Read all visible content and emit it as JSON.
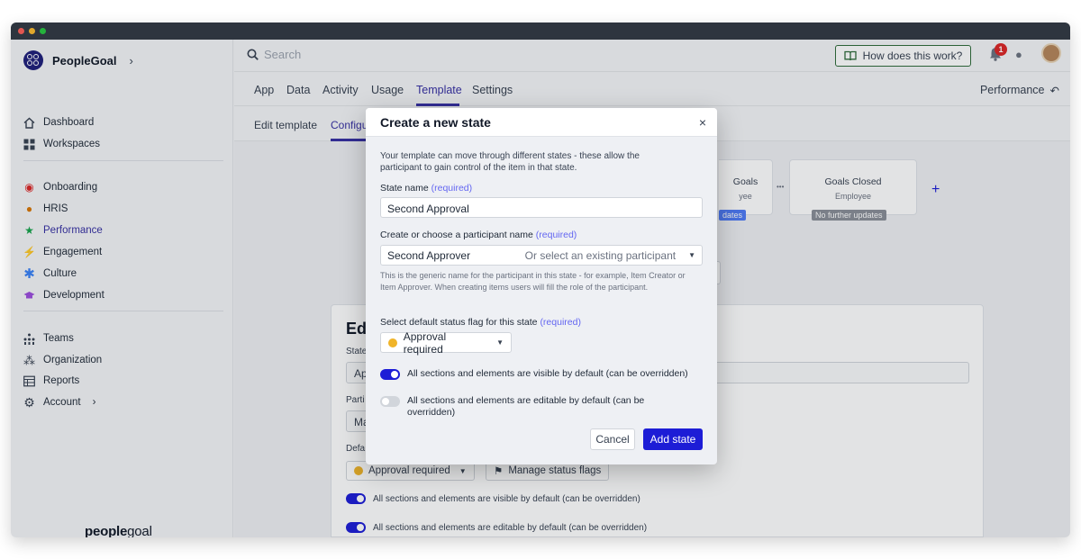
{
  "app": {
    "brand": "PeopleGoal",
    "footer_logo_bold": "people",
    "footer_logo_rest": "goal",
    "colors": {
      "accent": "#3730a3",
      "primary_button": "#1d1dd6",
      "status_yellow": "#f0b429",
      "toggle_on": "#1d1dd6"
    }
  },
  "sidebar": {
    "items": [
      {
        "label": "Dashboard",
        "icon": "home-icon"
      },
      {
        "label": "Workspaces",
        "icon": "grid-icon"
      },
      {
        "label": "Onboarding",
        "icon": "onboarding-icon"
      },
      {
        "label": "HRIS",
        "icon": "hris-icon"
      },
      {
        "label": "Performance",
        "icon": "star-icon"
      },
      {
        "label": "Engagement",
        "icon": "bolt-icon"
      },
      {
        "label": "Culture",
        "icon": "asterisk-icon"
      },
      {
        "label": "Development",
        "icon": "graduation-cap-icon"
      },
      {
        "label": "Teams",
        "icon": "teams-icon"
      },
      {
        "label": "Organization",
        "icon": "organization-icon"
      },
      {
        "label": "Reports",
        "icon": "table-icon"
      },
      {
        "label": "Account",
        "icon": "gear-icon"
      }
    ]
  },
  "topbar": {
    "search_placeholder": "Search",
    "help_label": "How does this work?",
    "notification_count": "1"
  },
  "tabs": {
    "items": [
      "App",
      "Data",
      "Activity",
      "Usage",
      "Template",
      "Settings"
    ],
    "active": "Template",
    "right_label": "Performance"
  },
  "subtabs": {
    "items": [
      "Edit template",
      "Configu"
    ]
  },
  "workflow": {
    "states": [
      {
        "title": "Goals",
        "sub": "yee",
        "pill": "dates"
      },
      {
        "title": "Goals Closed",
        "sub": "Employee",
        "pill": "No further updates"
      }
    ],
    "ellipsis": "•••",
    "add": "+"
  },
  "edit_panel": {
    "title": "Edi",
    "state_label": "State",
    "state_value": "Ap",
    "participant_label": "Parti",
    "participant_value": "Ma",
    "default_label": "Defa",
    "flag_value": "Approval required",
    "manage_flags": "Manage status flags",
    "toggle_visible": "All sections and elements are visible by default (can be overridden)",
    "toggle_editable": "All sections and elements are editable by default (can be overridden)"
  },
  "modal": {
    "title": "Create a new state",
    "close": "×",
    "intro": "Your template can move through different states - these allow the participant to gain control of the item in that state.",
    "state_name_label": "State name",
    "required": "(required)",
    "state_name_value": "Second Approval",
    "participant_label": "Create or choose a participant name",
    "participant_value": "Second Approver",
    "participant_select": "Or select an existing participant",
    "participant_help": "This is the generic name for the participant in this state - for example, Item Creator or Item Approver. When creating items users will fill the role of the participant.",
    "flag_label": "Select default status flag for this state",
    "flag_value": "Approval required",
    "toggle_visible": {
      "label": "All sections and elements are visible by default (can be overridden)",
      "on": true
    },
    "toggle_editable": {
      "label": "All sections and elements are editable by default (can be overridden)",
      "on": false
    },
    "cancel": "Cancel",
    "submit": "Add state"
  }
}
